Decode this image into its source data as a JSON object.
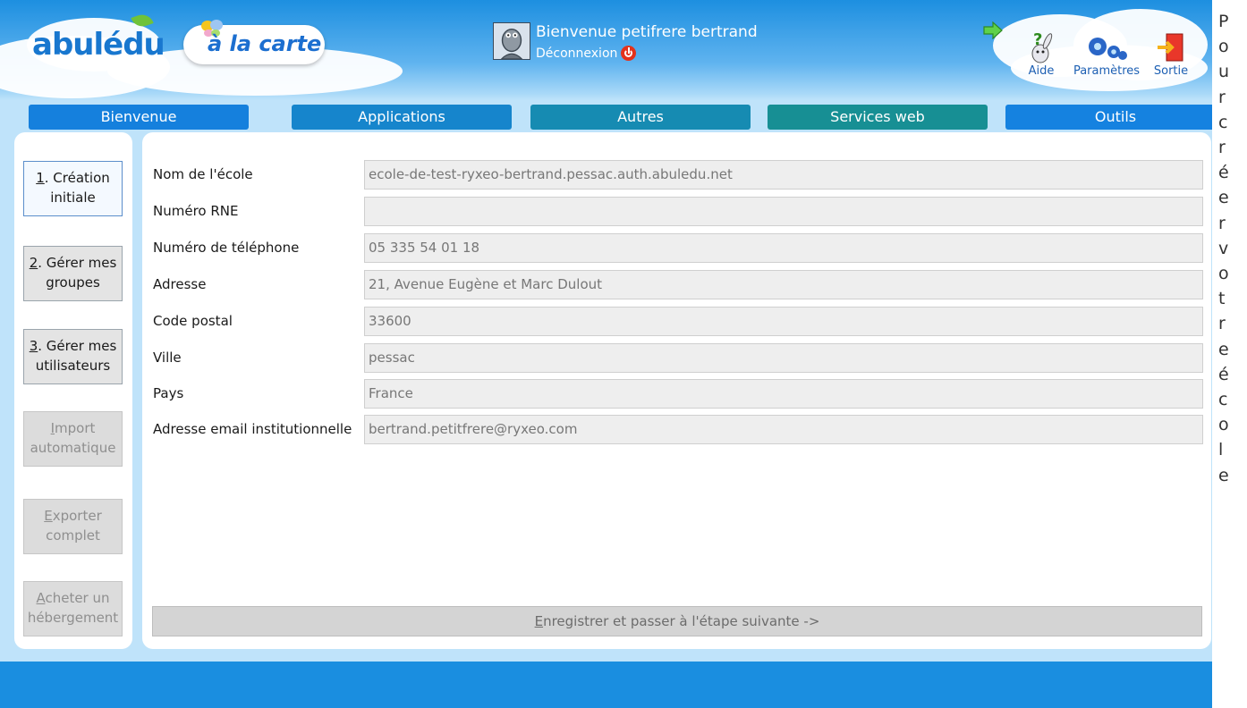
{
  "header": {
    "logo_text": "abulédu",
    "carte_text": "à la carte",
    "welcome": "Bienvenue petifrere bertrand",
    "logout": "Déconnexion"
  },
  "tools": [
    {
      "label": "Aide",
      "icon": "help-rabbit-icon"
    },
    {
      "label": "Paramètres",
      "icon": "gears-icon"
    },
    {
      "label": "Sortie",
      "icon": "exit-door-icon"
    }
  ],
  "nav": {
    "tabs": [
      {
        "label": "Bienvenue",
        "color": "#1580dd"
      },
      {
        "label": "Applications",
        "color": "#1685cc"
      },
      {
        "label": "Autres",
        "color": "#168bb2"
      },
      {
        "label": "Services web",
        "color": "#178f94"
      },
      {
        "label": "Outils",
        "color": "#1582e0"
      }
    ]
  },
  "sidebar": {
    "items": [
      {
        "key": "1",
        "rest": ". Création",
        "line2": "initiale",
        "state": "active"
      },
      {
        "key": "2",
        "rest": ". Gérer mes",
        "line2": "groupes",
        "state": "normal"
      },
      {
        "key": "3",
        "rest": ". Gérer mes",
        "line2": "utilisateurs",
        "state": "normal"
      },
      {
        "key": "I",
        "rest": "mport",
        "line2": "automatique",
        "state": "disabled"
      },
      {
        "key": "E",
        "rest": "xporter",
        "line2": "complet",
        "state": "disabled"
      },
      {
        "key": "A",
        "rest": "cheter un",
        "line2": "hébergement",
        "state": "disabled"
      }
    ]
  },
  "form": {
    "fields": [
      {
        "label": "Nom de l'école",
        "value": "ecole-de-test-ryxeo-bertrand.pessac.auth.abuledu.net"
      },
      {
        "label": "Numéro RNE",
        "value": ""
      },
      {
        "label": "Numéro de téléphone",
        "value": "05 335 54 01 18"
      },
      {
        "label": "Adresse",
        "value": "21, Avenue Eugène et Marc Dulout"
      },
      {
        "label": "Code postal",
        "value": "33600"
      },
      {
        "label": "Ville",
        "value": "pessac"
      },
      {
        "label": "Pays",
        "value": "France"
      },
      {
        "label": "Adresse email institutionnelle",
        "value": "bertrand.petitfrere@ryxeo.com"
      }
    ],
    "save_key": "E",
    "save_rest": "nregistrer et passer à l'étape suivante ->"
  },
  "side_text": [
    "P",
    "o",
    "u",
    "r",
    "c",
    "r",
    "é",
    "e",
    "r",
    "v",
    "o",
    "t",
    "r",
    "e",
    "é",
    "c",
    "o",
    "l",
    "e"
  ]
}
